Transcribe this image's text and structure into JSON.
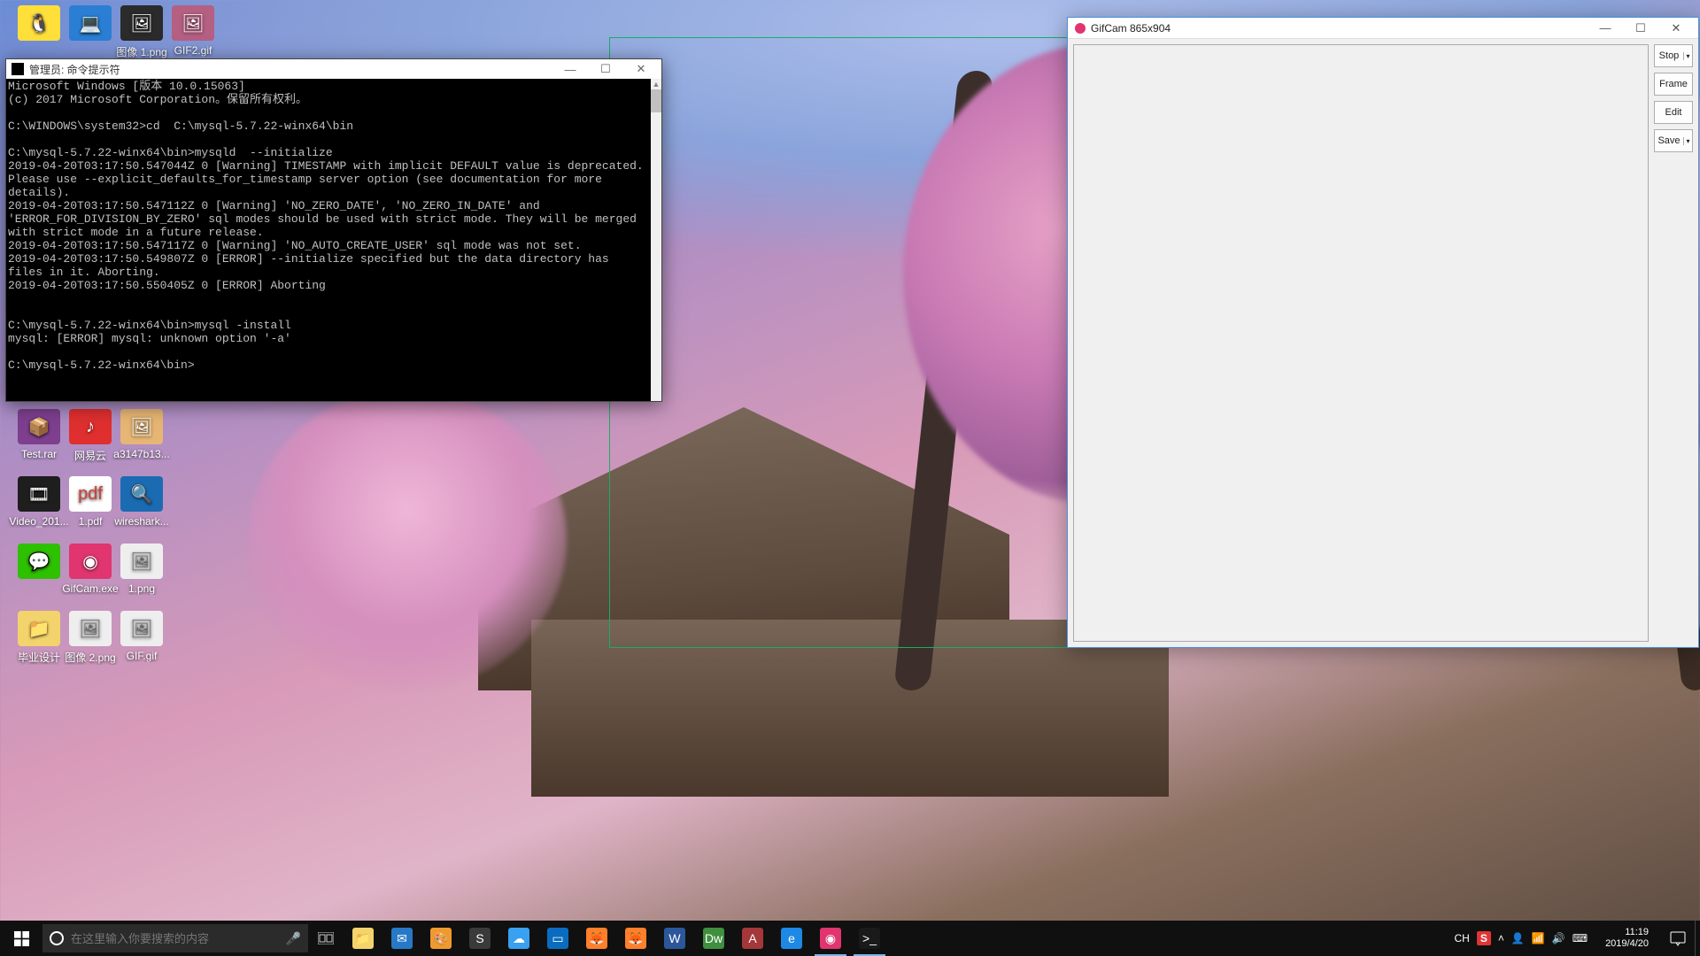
{
  "desktop": {
    "icons": [
      {
        "label": "",
        "bg": "#ffdf3a",
        "row": 0,
        "col": 0,
        "glyph": "🐧"
      },
      {
        "label": "",
        "bg": "#2a7fd4",
        "row": 0,
        "col": 1,
        "glyph": "💻"
      },
      {
        "label": "图像 1.png",
        "bg": "#2b2b2b",
        "row": 0,
        "col": 2,
        "glyph": "🖼"
      },
      {
        "label": "GIF2.gif",
        "bg": "#b55f82",
        "row": 0,
        "col": 3,
        "glyph": "🖼"
      },
      {
        "label": "Test.rar",
        "bg": "#7d3f8e",
        "row": 6,
        "col": 0,
        "glyph": "📦"
      },
      {
        "label": "网易云",
        "bg": "#e02f2f",
        "row": 6,
        "col": 1,
        "glyph": "♪"
      },
      {
        "label": "a3147b13...",
        "bg": "#e7b674",
        "row": 6,
        "col": 2,
        "glyph": "🖼"
      },
      {
        "label": "Video_201...",
        "bg": "#1e1e1e",
        "row": 7,
        "col": 0,
        "glyph": "🎞"
      },
      {
        "label": "1.pdf",
        "bg": "#ffffff",
        "row": 7,
        "col": 1,
        "glyph": "pdf",
        "fg": "#cf3f3a"
      },
      {
        "label": "wireshark...",
        "bg": "#1b6bb3",
        "row": 7,
        "col": 2,
        "glyph": "🔍"
      },
      {
        "label": "",
        "bg": "#2dc100",
        "row": 8,
        "col": 0,
        "glyph": "💬"
      },
      {
        "label": "GifCam.exe",
        "bg": "#e0356f",
        "row": 8,
        "col": 1,
        "glyph": "◉"
      },
      {
        "label": "1.png",
        "bg": "#eeeeee",
        "row": 8,
        "col": 2,
        "glyph": "🖼",
        "fg": "#666"
      },
      {
        "label": "毕业设计",
        "bg": "#f3d36b",
        "row": 9,
        "col": 0,
        "glyph": "📁"
      },
      {
        "label": "图像 2.png",
        "bg": "#eeeeee",
        "row": 9,
        "col": 1,
        "glyph": "🖼",
        "fg": "#666"
      },
      {
        "label": "GIF.gif",
        "bg": "#eeeeee",
        "row": 9,
        "col": 2,
        "glyph": "🖼",
        "fg": "#666"
      }
    ]
  },
  "cmd": {
    "title": "管理员: 命令提示符",
    "body": "Microsoft Windows [版本 10.0.15063]\n(c) 2017 Microsoft Corporation。保留所有权利。\n\nC:\\WINDOWS\\system32>cd  C:\\mysql-5.7.22-winx64\\bin\n\nC:\\mysql-5.7.22-winx64\\bin>mysqld  --initialize\n2019-04-20T03:17:50.547044Z 0 [Warning] TIMESTAMP with implicit DEFAULT value is deprecated. Please use --explicit_defaults_for_timestamp server option (see documentation for more details).\n2019-04-20T03:17:50.547112Z 0 [Warning] 'NO_ZERO_DATE', 'NO_ZERO_IN_DATE' and 'ERROR_FOR_DIVISION_BY_ZERO' sql modes should be used with strict mode. They will be merged with strict mode in a future release.\n2019-04-20T03:17:50.547117Z 0 [Warning] 'NO_AUTO_CREATE_USER' sql mode was not set.\n2019-04-20T03:17:50.549807Z 0 [ERROR] --initialize specified but the data directory has files in it. Aborting.\n2019-04-20T03:17:50.550405Z 0 [ERROR] Aborting\n\n\nC:\\mysql-5.7.22-winx64\\bin>mysql -install\nmysql: [ERROR] mysql: unknown option '-a'\n\nC:\\mysql-5.7.22-winx64\\bin>"
  },
  "gifcam": {
    "title": "GifCam 865x904",
    "btn_stop": "Stop",
    "btn_frame": "Frame",
    "btn_edit": "Edit",
    "btn_save": "Save"
  },
  "taskbar": {
    "search_placeholder": "在这里输入你要搜索的内容",
    "ime": "CH",
    "time": "11:19",
    "date": "2019/4/20",
    "items": [
      {
        "bg": "#f3d36b",
        "glyph": "📁",
        "active": false
      },
      {
        "bg": "#2779c7",
        "glyph": "✉",
        "active": false
      },
      {
        "bg": "#ef9a2e",
        "glyph": "🎨",
        "active": false
      },
      {
        "bg": "#3a3a3a",
        "glyph": "S",
        "active": false
      },
      {
        "bg": "#3aa0f0",
        "glyph": "☁",
        "active": false
      },
      {
        "bg": "#0a6cc1",
        "glyph": "▭",
        "active": false
      },
      {
        "bg": "#ff7f2a",
        "glyph": "🦊",
        "active": false
      },
      {
        "bg": "#ff7f2a",
        "glyph": "🦊",
        "active": false
      },
      {
        "bg": "#2b579a",
        "glyph": "W",
        "active": false
      },
      {
        "bg": "#3f8f3f",
        "glyph": "Dw",
        "active": false
      },
      {
        "bg": "#a4373a",
        "glyph": "A",
        "active": false
      },
      {
        "bg": "#1e88e5",
        "glyph": "e",
        "active": false
      },
      {
        "bg": "#e0356f",
        "glyph": "◉",
        "active": true
      },
      {
        "bg": "#1a1a1a",
        "glyph": ">_",
        "active": true
      }
    ]
  }
}
